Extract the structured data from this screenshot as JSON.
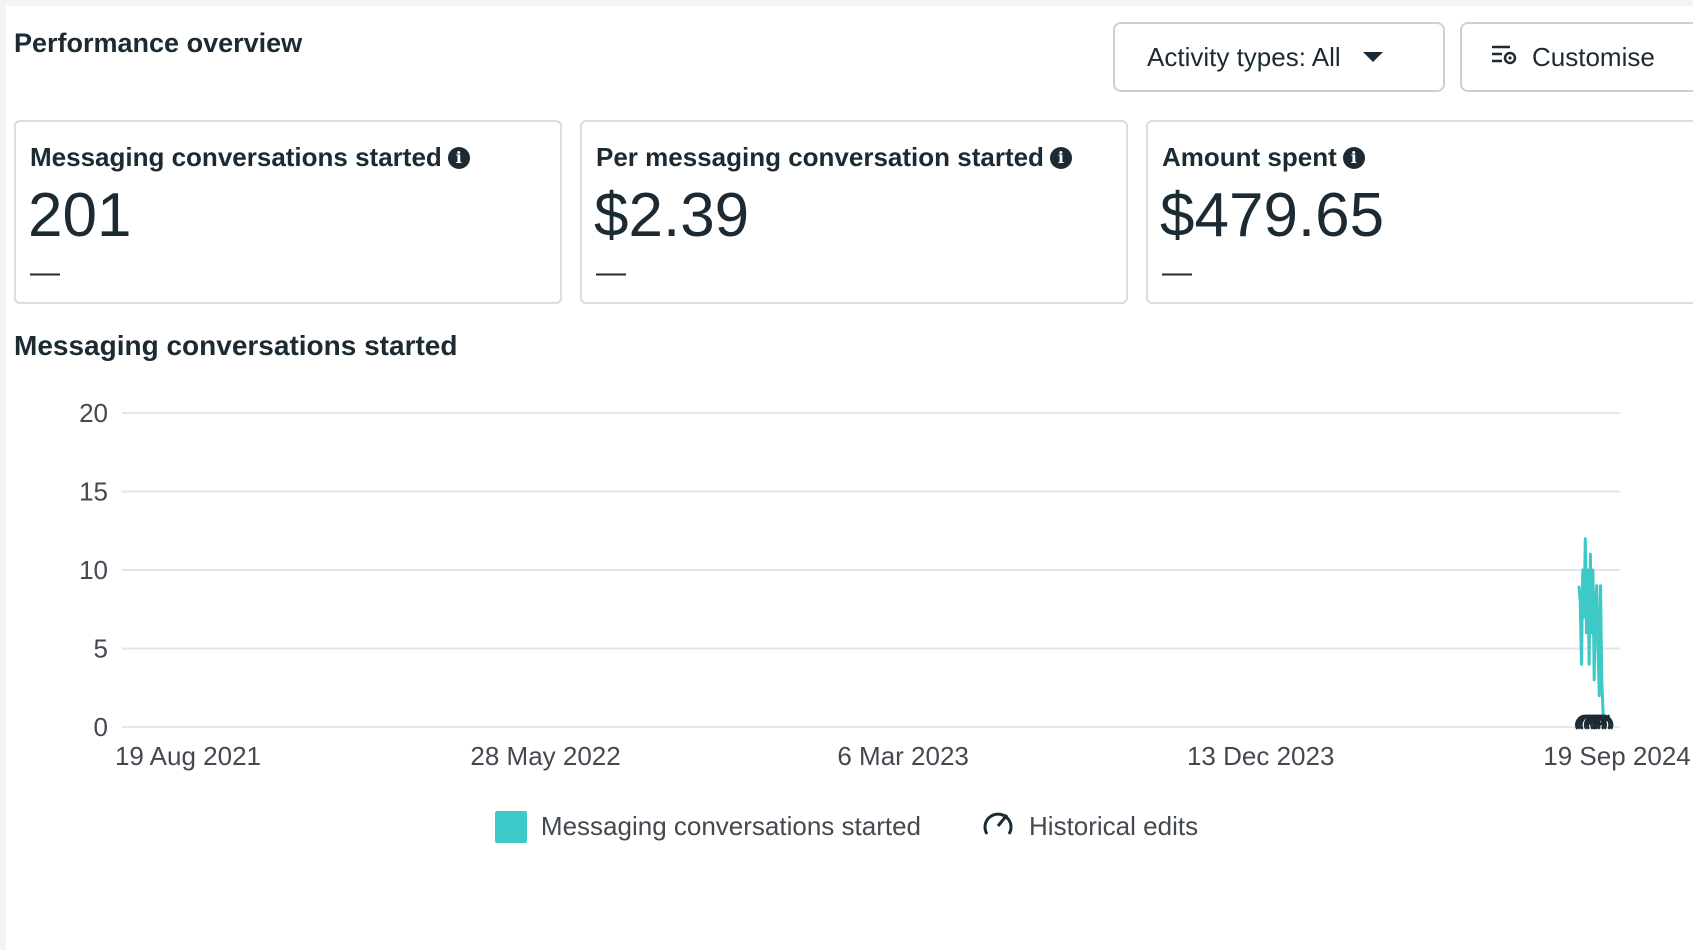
{
  "header": {
    "title": "Performance overview",
    "activity_button": "Activity types: All",
    "customise_button": "Customise"
  },
  "metrics": [
    {
      "label": "Messaging conversations started",
      "value": "201",
      "delta": "—"
    },
    {
      "label": "Per messaging conversation started",
      "value": "$2.39",
      "delta": "—"
    },
    {
      "label": "Amount spent",
      "value": "$479.65",
      "delta": "—"
    }
  ],
  "chart_section": {
    "title": "Messaging conversations started"
  },
  "legend": {
    "series_label": "Messaging conversations started",
    "edits_label": "Historical edits"
  },
  "colors": {
    "series": "#3cc9c8",
    "grid": "#e4e6eb",
    "text": "#1c2b33"
  },
  "chart_data": {
    "type": "line",
    "title": "Messaging conversations started",
    "xlabel": "",
    "ylabel": "",
    "ylim": [
      0,
      20
    ],
    "yticks": [
      0,
      5,
      10,
      15,
      20
    ],
    "xticks": [
      "19 Aug 2021",
      "28 May 2022",
      "6 Mar 2023",
      "13 Dec 2023",
      "19 Sep 2024"
    ],
    "grid": true,
    "legend_position": "bottom",
    "series": [
      {
        "name": "Messaging conversations started",
        "points": [
          [
            "2024-08-20",
            9
          ],
          [
            "2024-08-21",
            8
          ],
          [
            "2024-08-22",
            4
          ],
          [
            "2024-08-23",
            10
          ],
          [
            "2024-08-24",
            7
          ],
          [
            "2024-08-25",
            12
          ],
          [
            "2024-08-26",
            6
          ],
          [
            "2024-08-27",
            10
          ],
          [
            "2024-08-28",
            4
          ],
          [
            "2024-08-29",
            11
          ],
          [
            "2024-08-30",
            6
          ],
          [
            "2024-08-31",
            10
          ],
          [
            "2024-09-01",
            3
          ],
          [
            "2024-09-02",
            8
          ],
          [
            "2024-09-03",
            9
          ],
          [
            "2024-09-04",
            5
          ],
          [
            "2024-09-05",
            2
          ],
          [
            "2024-09-06",
            9
          ],
          [
            "2024-09-07",
            3
          ],
          [
            "2024-09-08",
            1
          ],
          [
            "2024-09-09",
            0
          ]
        ]
      }
    ],
    "historical_edits": [
      "2024-08-25",
      "2024-08-27",
      "2024-08-29",
      "2024-09-01",
      "2024-09-03",
      "2024-09-06",
      "2024-09-08"
    ]
  }
}
